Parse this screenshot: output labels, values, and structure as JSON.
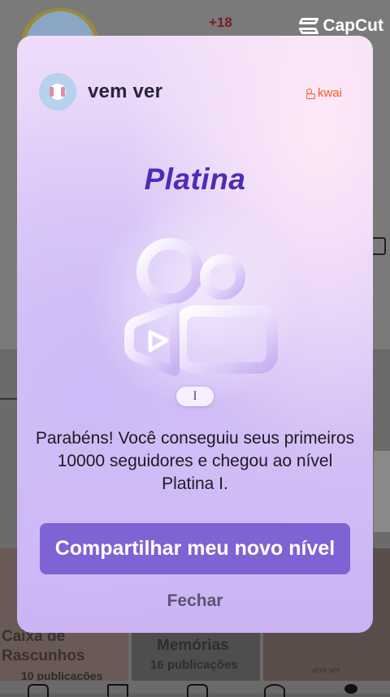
{
  "background": {
    "badge": "+18",
    "drafts_title": "Caixa de Rascunhos",
    "drafts_count": "10 publicações",
    "memories_title": "Memórias",
    "memories_count": "16 publicações",
    "thumb_caption": "vem ver"
  },
  "watermark": {
    "label": "CapCut"
  },
  "modal": {
    "username": "vem ver",
    "brand": "kwai",
    "level_title": "Platina",
    "level_tier": "I",
    "message": "Parabéns! Você conseguiu seus primeiros 10000 seguidores e chegou ao nível Platina I.",
    "share_label": "Compartilhar meu novo nível",
    "close_label": "Fechar",
    "accent_color": "#7f62d3",
    "title_color": "#4e2db6",
    "brand_color": "#ff5a1f"
  }
}
